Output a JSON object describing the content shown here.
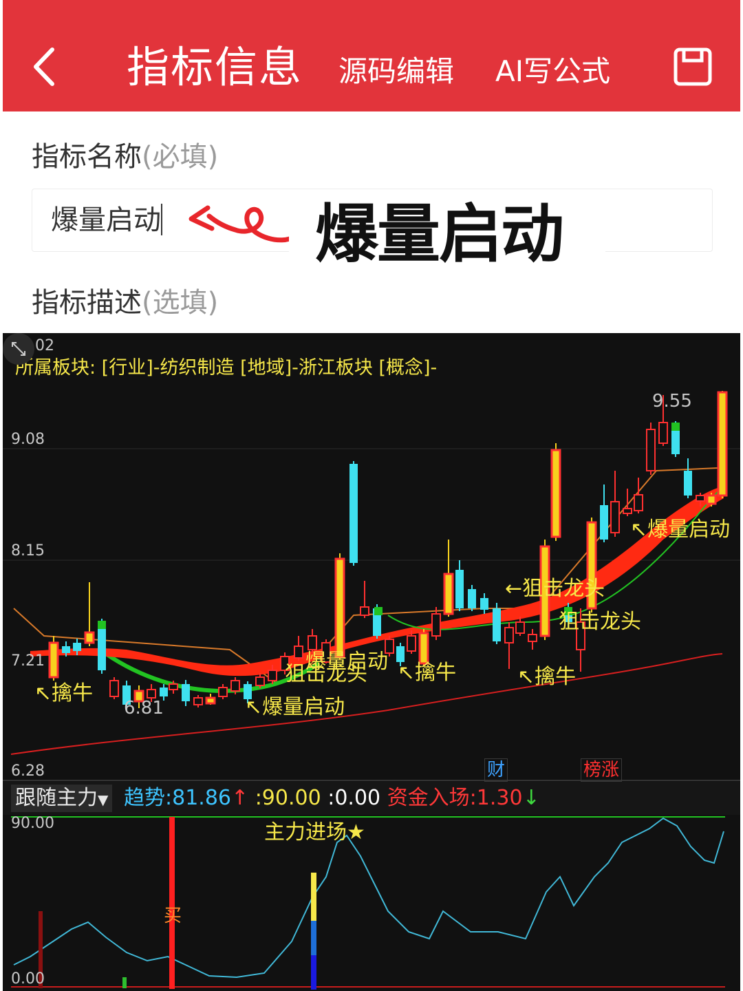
{
  "header": {
    "back_icon": "chevron-left-icon",
    "title": "指标信息",
    "tab_source": "源码编辑",
    "tab_ai": "AI写公式",
    "save_icon": "save-icon"
  },
  "form": {
    "name_label": "指标名称",
    "name_hint": "(必填)",
    "name_value": "爆量启动",
    "desc_label": "指标描述",
    "desc_hint": "(选填)"
  },
  "annotation": {
    "text": "爆量启动"
  },
  "chart": {
    "sector_info": "所属板块: [行业]-纺织制造 [地域]-浙江板块 [概念]-",
    "price_ticks": [
      "10.02",
      "9.08",
      "8.15",
      "7.21",
      "6.28"
    ],
    "high_label": "9.55",
    "low_label": "6.81",
    "marks": {
      "qinniu": "擒牛",
      "baoliang": "爆量启动",
      "juji": "狙击龙头"
    },
    "tags": {
      "cai": "财",
      "bang": "榜涨"
    },
    "colors": {
      "up": "#ff3030",
      "down": "#3fe0f0",
      "yellow": "#f7d21e",
      "ma_green": "#22c322"
    }
  },
  "indicator": {
    "name": "跟随主力",
    "dropdown_icon": "triangle-down-icon",
    "trend_label": "趋势:81.86",
    "trend_arrow": "↑",
    "v90": ":90.00",
    "v0": ":0.00",
    "fund_label": "资金入场:1.30",
    "fund_arrow": "↓",
    "expand_icon": "expand-icon",
    "top_tick": "90.00",
    "bottom_tick": "0.00",
    "main_in": "主力进场★",
    "buy": "买"
  }
}
